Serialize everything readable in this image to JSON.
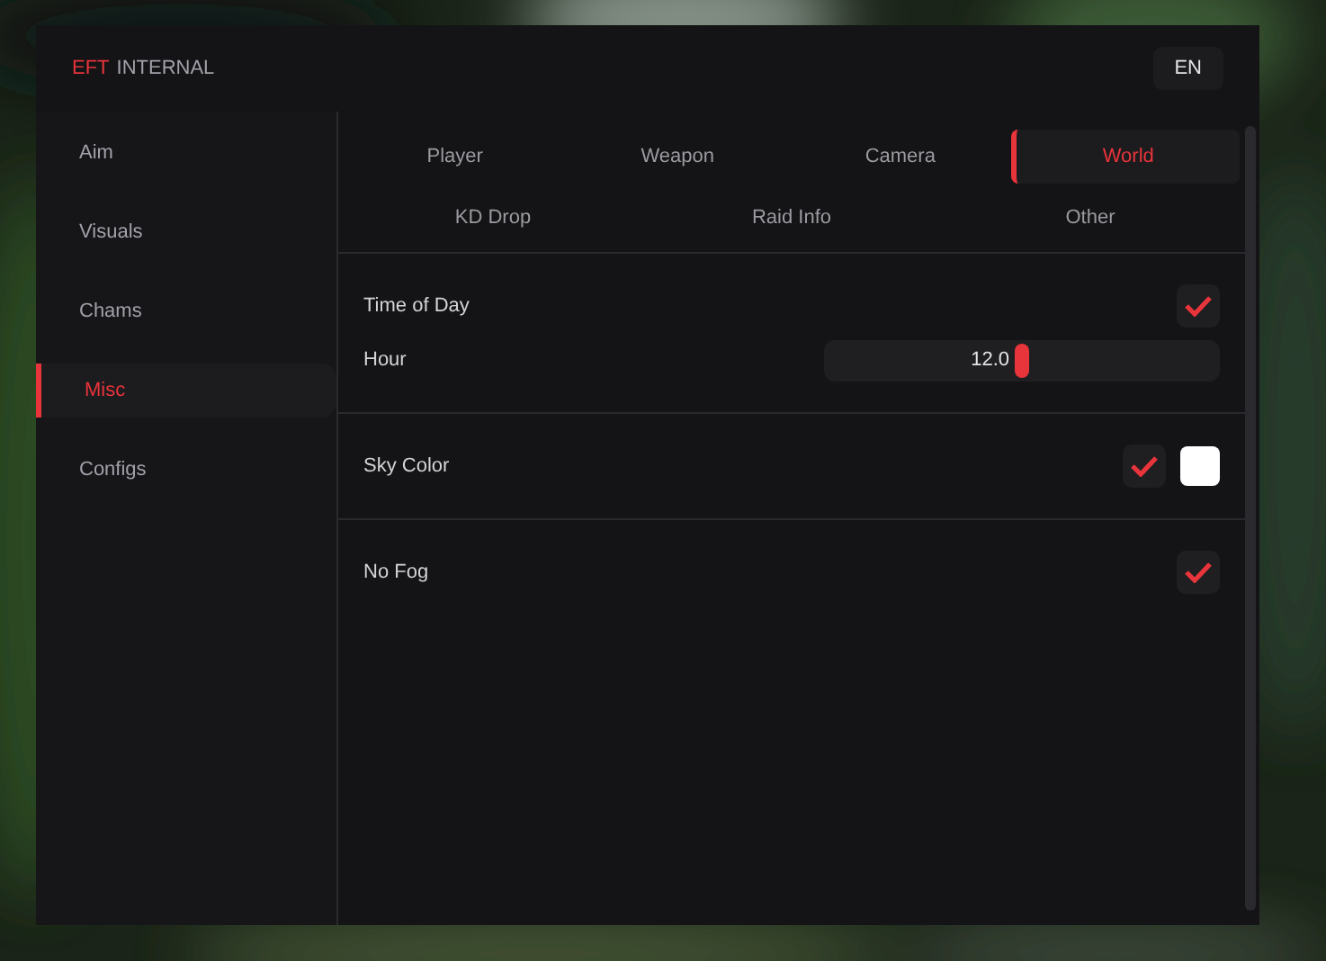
{
  "brand": {
    "accent": "EFT",
    "name": "INTERNAL"
  },
  "language_button": "EN",
  "sidebar": {
    "items": [
      {
        "label": "Aim",
        "selected": false
      },
      {
        "label": "Visuals",
        "selected": false
      },
      {
        "label": "Chams",
        "selected": false
      },
      {
        "label": "Misc",
        "selected": true
      },
      {
        "label": "Configs",
        "selected": false
      }
    ]
  },
  "tabs": [
    {
      "label": "Player",
      "selected": false
    },
    {
      "label": "Weapon",
      "selected": false
    },
    {
      "label": "Camera",
      "selected": false
    },
    {
      "label": "World",
      "selected": true
    }
  ],
  "subtabs": [
    {
      "label": "KD Drop",
      "selected": false
    },
    {
      "label": "Raid Info",
      "selected": false
    },
    {
      "label": "Other",
      "selected": false
    }
  ],
  "sections": [
    {
      "rows": [
        {
          "kind": "checkbox",
          "label": "Time of Day",
          "checked": true
        },
        {
          "kind": "slider",
          "label": "Hour",
          "value": "12.0",
          "level": 0.5
        }
      ]
    },
    {
      "rows": [
        {
          "kind": "checkbox_color",
          "label": "Sky Color",
          "checked": true,
          "color": "#ffffff"
        }
      ]
    },
    {
      "rows": [
        {
          "kind": "checkbox",
          "label": "No Fog",
          "checked": true
        }
      ]
    }
  ]
}
